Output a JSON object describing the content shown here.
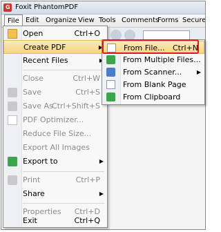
{
  "window": {
    "title": "Foxit PhantomPDF"
  },
  "menubar": [
    "File",
    "Edit",
    "Organize",
    "View",
    "Tools",
    "Comments",
    "Forms",
    "Secure"
  ],
  "file_menu": {
    "open": {
      "label": "Open",
      "shortcut": "Ctrl+O"
    },
    "create_pdf": {
      "label": "Create PDF"
    },
    "recent_files": {
      "label": "Recent Files"
    },
    "close": {
      "label": "Close",
      "shortcut": "Ctrl+W"
    },
    "save": {
      "label": "Save",
      "shortcut": "Ctrl+S"
    },
    "save_as": {
      "label": "Save As",
      "shortcut": "Ctrl+Shift+S"
    },
    "pdf_optimizer": {
      "label": "PDF Optimizer..."
    },
    "reduce_file_size": {
      "label": "Reduce File Size..."
    },
    "export_all_images": {
      "label": "Export All Images"
    },
    "export_to": {
      "label": "Export to"
    },
    "print": {
      "label": "Print",
      "shortcut": "Ctrl+P"
    },
    "share": {
      "label": "Share"
    },
    "properties": {
      "label": "Properties",
      "shortcut": "Ctrl+D"
    },
    "exit": {
      "label": "Exit",
      "shortcut": "Ctrl+Q"
    }
  },
  "create_submenu": {
    "from_file": {
      "label": "From File...",
      "shortcut": "Ctrl+N"
    },
    "from_multiple_files": {
      "label": "From Multiple Files..."
    },
    "from_scanner": {
      "label": "From Scanner..."
    },
    "from_blank_page": {
      "label": "From Blank Page"
    },
    "from_clipboard": {
      "label": "From Clipboard"
    }
  },
  "colors": {
    "highlight": "#f6d77f",
    "callout": "#e0191f",
    "app_icon": "#c8382c"
  }
}
